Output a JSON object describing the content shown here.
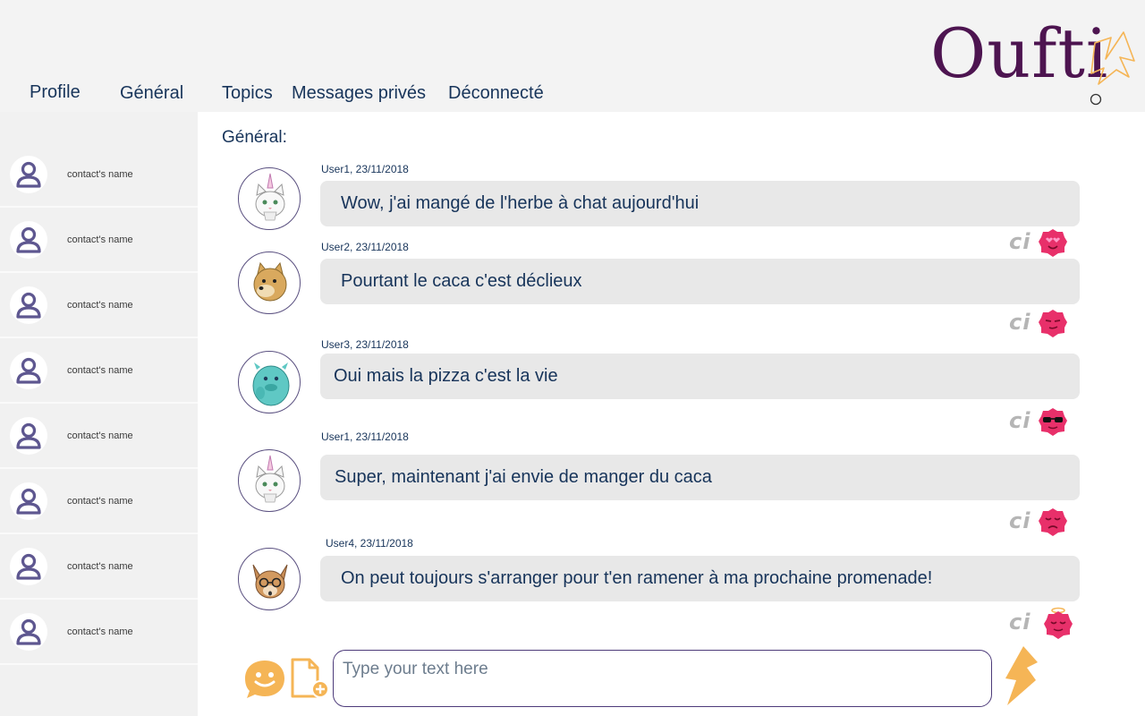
{
  "app": {
    "logo": "Oufti"
  },
  "nav": [
    {
      "label": "Profile"
    },
    {
      "label": "Général"
    },
    {
      "label": "Topics"
    },
    {
      "label": "Messages privés"
    },
    {
      "label": "Déconnecté"
    }
  ],
  "contacts": [
    {
      "name": "contact's name"
    },
    {
      "name": "contact's name"
    },
    {
      "name": "contact's name"
    },
    {
      "name": "contact's name"
    },
    {
      "name": "contact's name"
    },
    {
      "name": "contact's name"
    },
    {
      "name": "contact's name"
    },
    {
      "name": "contact's name"
    }
  ],
  "channel": {
    "title": "Général:"
  },
  "messages": [
    {
      "meta": "User1, 23/11/2018",
      "text": "Wow, j'ai mangé de l'herbe à chat aujourd'hui",
      "avatar": "unicorn-cat-icon",
      "reaction": "heart-eyes"
    },
    {
      "meta": "User2, 23/11/2018",
      "text": "Pourtant le caca c'est déclieux",
      "avatar": "shiba-doge-icon",
      "reaction": "smirk"
    },
    {
      "meta": "User3, 23/11/2018",
      "text": "Oui mais la pizza c'est la vie",
      "avatar": "teal-monster-icon",
      "reaction": "sunglasses"
    },
    {
      "meta": "User1, 23/11/2018",
      "text": "Super, maintenant j'ai envie de manger du caca",
      "avatar": "unicorn-cat-icon",
      "reaction": "sad"
    },
    {
      "meta": "User4, 23/11/2018",
      "text": "On peut toujours s'arranger pour t'en ramener à ma prochaine promenade!",
      "avatar": "nerd-dog-icon",
      "reaction": "angel"
    }
  ],
  "reaction_label": "ci",
  "composer": {
    "placeholder": "Type your text here"
  },
  "colors": {
    "header_bg": "#f3f3f3",
    "sidebar_bg": "#f1f1f1",
    "bubble_bg": "#e8e8e8",
    "text": "#17345a",
    "logo": "#4d1450",
    "accent_orange": "#f5b556",
    "reaction_red": "#e8306a"
  }
}
